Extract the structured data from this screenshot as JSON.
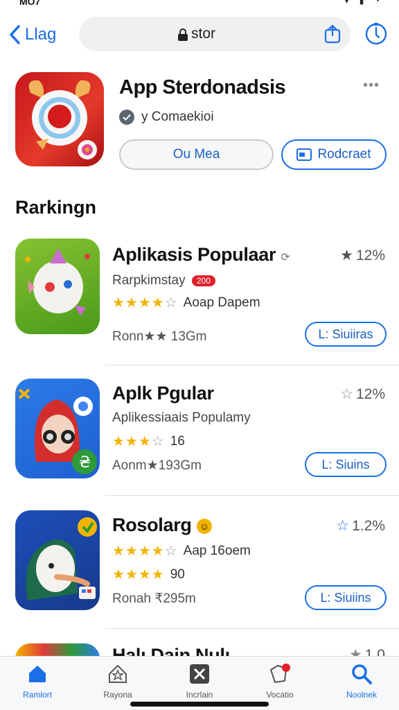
{
  "status": {
    "time": "MO7",
    "icons": "▾ ▮ ◔"
  },
  "nav": {
    "back_label": "Llag",
    "url": "stor"
  },
  "hero": {
    "title": "App Sterdonadsis",
    "developer": "y Comaekioi",
    "open_label": "Ou Mea",
    "report_label": "Rodcraet"
  },
  "section_title": "Rarkingn",
  "apps": [
    {
      "name": "Aplikasis Populaar",
      "subtitle": "Rarpkimstay",
      "badge": "200",
      "stars_on": 4,
      "stars_off": 1,
      "rating_text": "Aoap Dapem",
      "meta": "Ronn★★ 13Gm",
      "rank": "12%",
      "get_label": "L: Siuiiras"
    },
    {
      "name": "Aplk Pgular",
      "subtitle": "Aplikessiaais Populamy",
      "stars_on": 3,
      "stars_off": 1,
      "rating_text": "16",
      "meta": "Aonm★193Gm",
      "rank": "12%",
      "get_label": "L: Siuins"
    },
    {
      "name": "Rosolarg",
      "subtitle": "",
      "stars_on": 4,
      "stars_off": 1,
      "rating_text": "Aap 16oem",
      "stars2_text": "90",
      "meta": "Ronah ₹295m",
      "rank": "1.2%",
      "get_label": "L: Siuiins"
    },
    {
      "name": "Halı Dain Nulı",
      "rank": "1.0"
    }
  ],
  "tabs": [
    {
      "label": "Ramlort",
      "icon": "home-icon",
      "active": true
    },
    {
      "label": "Rayona",
      "icon": "star-tab-icon"
    },
    {
      "label": "Incrlain",
      "icon": "games-icon"
    },
    {
      "label": "Vocatio",
      "icon": "updates-icon"
    },
    {
      "label": "Noolnek",
      "icon": "search-icon",
      "active": true
    }
  ],
  "colors": {
    "accent": "#1a6ee6",
    "star": "#f2b400",
    "hero_bg": "#c5171c"
  }
}
